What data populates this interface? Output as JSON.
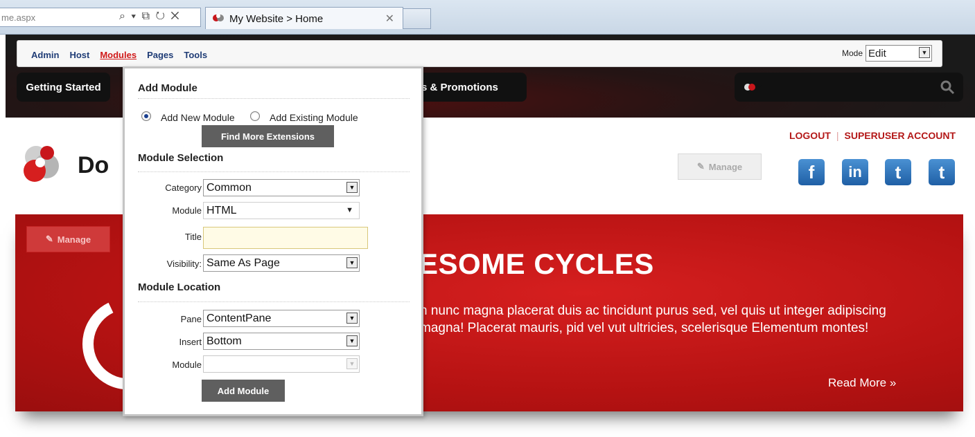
{
  "browser": {
    "address": "me.aspx",
    "tab_title": "My Website > Home",
    "tab_close": "✕",
    "address_icons": "⌕ ▾ ⧉ ↻ ✕"
  },
  "control_bar": {
    "menu": [
      "Admin",
      "Host",
      "Modules",
      "Pages",
      "Tools"
    ],
    "mode_label": "Mode",
    "mode_value": "Edit"
  },
  "nav": {
    "item1": "Getting Started",
    "item2": "ews & Promotions"
  },
  "account": {
    "logout": "LOGOUT",
    "separator": "|",
    "superuser": "SUPERUSER ACCOUNT"
  },
  "logo_text": "Do",
  "manage_label": "Manage",
  "social": [
    "f",
    "in",
    "t",
    "t"
  ],
  "banner": {
    "title": "ESOME CYCLES",
    "text": "n nunc magna placerat duis ac tincidunt purus sed, vel quis ut integer adipiscing magna! Placerat mauris, pid vel vut ultricies, scelerisque Elementum montes!",
    "read_more": "Read More »"
  },
  "popup": {
    "add_module_header": "Add Module",
    "radio_new": "Add New Module",
    "radio_existing": "Add Existing Module",
    "find_more": "Find More Extensions",
    "module_selection_header": "Module Selection",
    "category_label": "Category",
    "category_value": "Common",
    "module_label": "Module",
    "module_value": "HTML",
    "title_label": "Title",
    "title_value": "",
    "visibility_label": "Visibility:",
    "visibility_value": "Same As Page",
    "module_location_header": "Module Location",
    "pane_label": "Pane",
    "pane_value": "ContentPane",
    "insert_label": "Insert",
    "insert_value": "Bottom",
    "module2_label": "Module",
    "module2_value": "",
    "add_module_button": "Add Module"
  },
  "colors": {
    "accent_red": "#c8161b",
    "link_blue": "#1f3c76",
    "button_gray": "#5f5f5f"
  }
}
